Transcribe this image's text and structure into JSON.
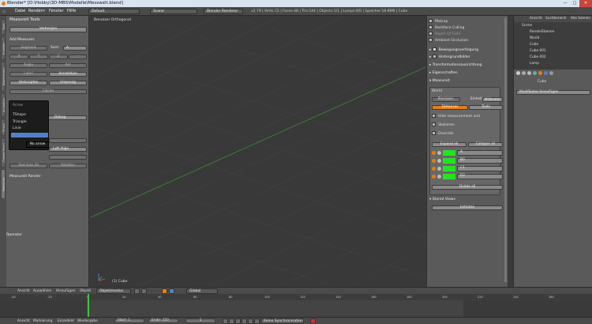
{
  "window": {
    "title": "Blender* [D:\\Hobby\\3D-MBS\\Modelle\\Messwelt.blend]",
    "min": "—",
    "max": "□",
    "close": "✕"
  },
  "menu": {
    "items": [
      "Datei",
      "Rendern",
      "Fenster",
      "Hilfe"
    ],
    "layout": "Default",
    "scene": "Scene",
    "engine": "Blender Renderer",
    "stats": "v2.79 | Verts:72 | Faces:48 | Tris:144 | Objects:1/1 | Lamps:0/0 | Speicher:18.89M | Cube"
  },
  "tool": {
    "panel_title": "Measureit Tools",
    "hide_label": "Verbergen",
    "add_title": "Add Measures",
    "segment": "Segment",
    "sum_label": "Sum:",
    "sum_value": "A",
    "angle": "Angle",
    "arc": "Arc",
    "label": "Label",
    "annotation": "Annotation",
    "link": "Verknüpfen",
    "origin": "Ursprung",
    "area": "Fläche",
    "debug": "Debug",
    "text_size": "Text Size",
    "textsize_value": "20",
    "rotation": "Rotation",
    "left_align": "Left Align",
    "measureit_render": "Measureit Render",
    "operator": "Operator",
    "tabs": [
      "Tools",
      "Erstellen",
      "Beziehungen",
      "Animation",
      "Physik",
      "Grease Pencil",
      "Measureit"
    ]
  },
  "popup": {
    "title": "Arrow",
    "items": [
      "TShape",
      "Triangle",
      "Linie",
      "-"
    ],
    "tooltip": "No arrow"
  },
  "viewport": {
    "label": "Benutzer Orthogonal",
    "object": "(1) Cube"
  },
  "props": {
    "items": [
      "Matcap",
      "Backface Culling",
      "Depth Of Field",
      "Ambient Occlusion"
    ],
    "motion_tracking": "Bewegungsverfolgung",
    "background": "Hintergrundbilder",
    "transform_orient": "Transformationsausrichtung",
    "properties": "Eigenschaften",
    "measureit": "Measureit",
    "world": "World",
    "precision": "Precision:",
    "units": "Einheit:",
    "units_value": "Millimeter",
    "distances": "Distances",
    "texts": "Texts",
    "hide": "Hide measurement unit",
    "scale": "Skalieren",
    "override": "Override",
    "expand": "Expand all",
    "collapse": "Collapse all",
    "rows": [
      "A",
      "B0",
      "C1",
      "D2"
    ],
    "delete_all": "Delete all",
    "stored_views": "Stored Views",
    "initialize": "Initialize"
  },
  "outliner": {
    "tabs": [
      "Ansicht",
      "Suchbereich",
      "Alle Szenen"
    ],
    "items": [
      "Scene",
      "RenderEbenen",
      "World",
      "Cube",
      "Cube.001",
      "Cube.002",
      "Lamp",
      "Camera"
    ]
  },
  "rprops": {
    "object": "Cube",
    "modifier": "Modifikator hinzufügen"
  },
  "v3dheader": {
    "items": [
      "Ansicht",
      "Auswählen",
      "Hinzufügen",
      "Objekt"
    ],
    "mode": "Objektmodus",
    "orientation": "Global"
  },
  "timeline": {
    "ticks": [
      "-40",
      "-20",
      "0",
      "20",
      "40",
      "60",
      "80",
      "100",
      "120",
      "140",
      "160",
      "180",
      "200",
      "220",
      "240",
      "260"
    ],
    "header": [
      "Ansicht",
      "Markierung",
      "Einzelbild",
      "Wiedergabe"
    ],
    "start": "Start:",
    "start_value": "1",
    "end": "Ende:",
    "end_value": "250",
    "frame": "1",
    "sync": "Keine Synchronisation"
  },
  "colors": {
    "accent": "#e87d0d",
    "selected": "#5680c2",
    "green": "#22e422"
  }
}
